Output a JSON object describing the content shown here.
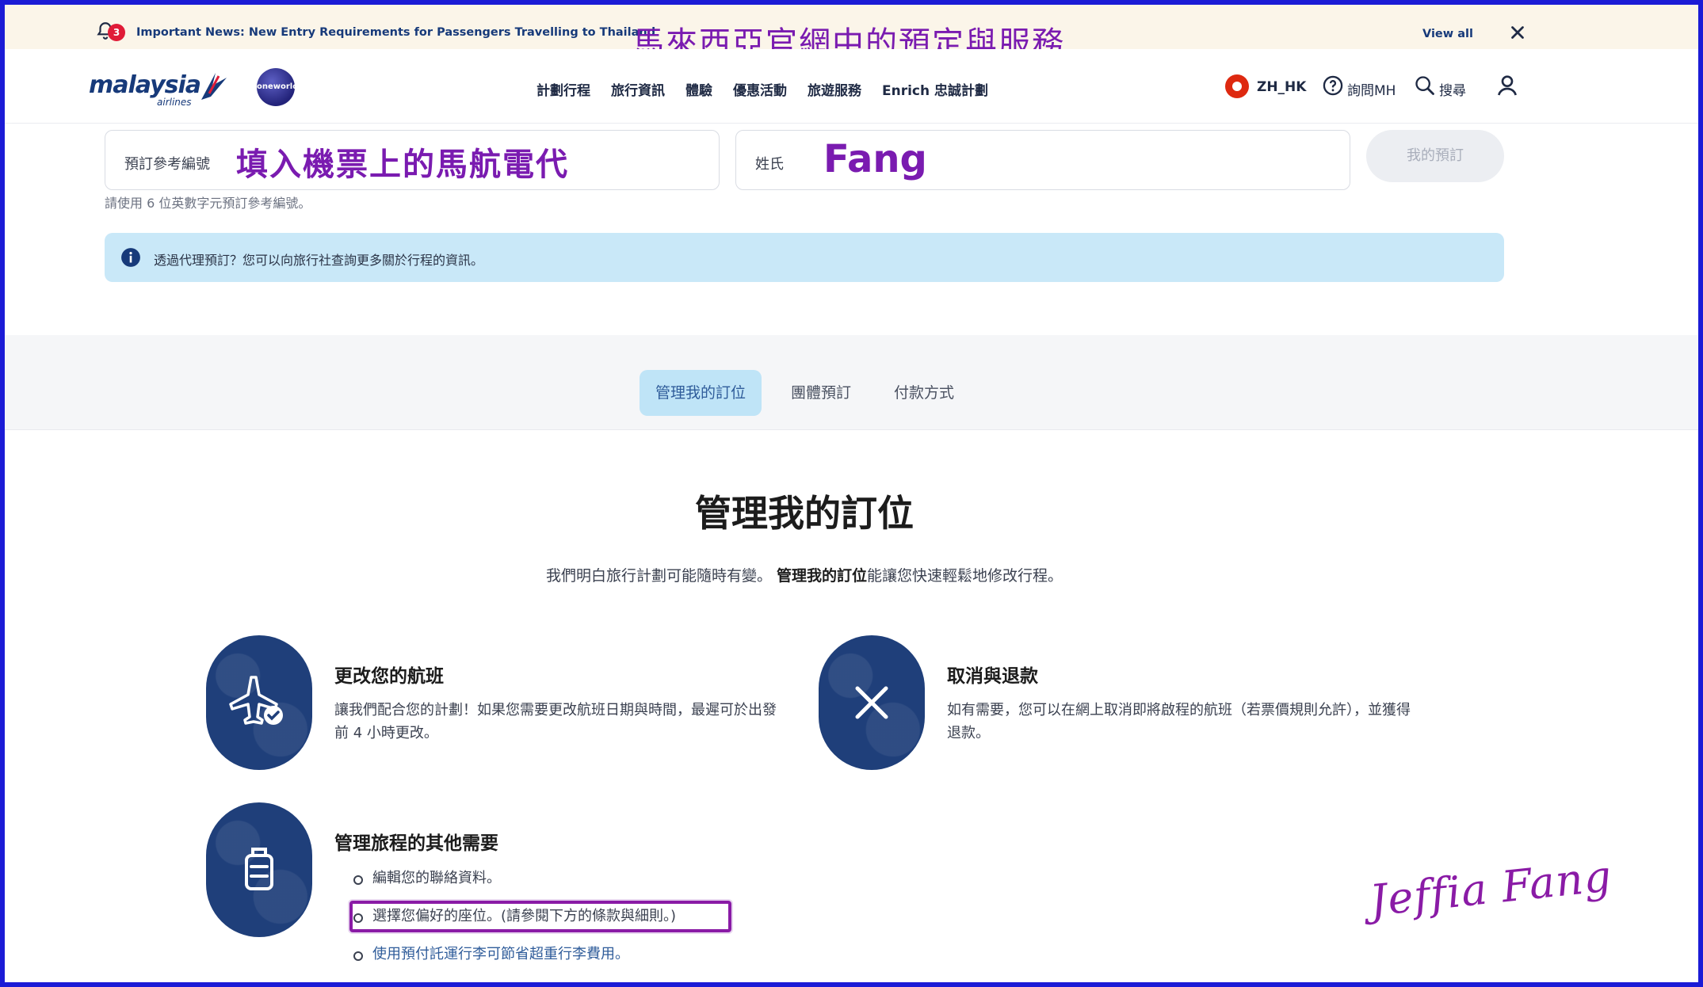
{
  "news": {
    "badge_count": "3",
    "text": "Important News: New Entry Requirements for Passengers Travelling to Thailand",
    "overlay_title": "馬來西亞官網中的預定與服務",
    "view_all": "View all"
  },
  "header": {
    "logo_text": "malaysia",
    "logo_sub": "airlines",
    "oneworld": "oneworld",
    "nav": [
      "計劃行程",
      "旅行資訊",
      "體驗",
      "優惠活動",
      "旅遊服務",
      "Enrich 忠誠計劃"
    ],
    "language": "ZH_HK",
    "help": "詢問MH",
    "search": "搜尋"
  },
  "lookup": {
    "booking_ref_label": "預訂參考編號",
    "booking_ref_value": "填入機票上的馬航電代",
    "surname_label": "姓氏",
    "surname_value": "Fang",
    "submit_label": "我的預訂",
    "hint": "請使用 6 位英數字元預訂參考編號。",
    "info": "透過代理預訂？您可以向旅行社查詢更多關於行程的資訊。"
  },
  "tabs": [
    {
      "label": "管理我的訂位",
      "active": true
    },
    {
      "label": "團體預訂",
      "active": false
    },
    {
      "label": "付款方式",
      "active": false
    }
  ],
  "content": {
    "title": "管理我的訂位",
    "intro_before": "我們明白旅行計劃可能隨時有變。",
    "intro_bold": "管理我的訂位",
    "intro_after": "能讓您快速輕鬆地修改行程。",
    "cards": [
      {
        "title": "更改您的航班",
        "desc": "讓我們配合您的計劃！如果您需要更改航班日期與時間，最遲可於出發前 4 小時更改。"
      },
      {
        "title": "取消與退款",
        "desc": "如有需要，您可以在網上取消即將啟程的航班（若票價規則允許），並獲得退款。"
      },
      {
        "title": "管理旅程的其他需要",
        "bullets": [
          "編輯您的聯絡資料。",
          "選擇您偏好的座位。(請參閱下方的條款與細則。)",
          "使用預付託運行李可節省超重行李費用。"
        ]
      }
    ],
    "signature": "Jeffia Fang"
  },
  "colors": {
    "brand_navy": "#1f3f7a",
    "overlay_purple": "#7a1bb0",
    "info_blue": "#c9e8f8",
    "tab_active": "#bfe4f7"
  }
}
